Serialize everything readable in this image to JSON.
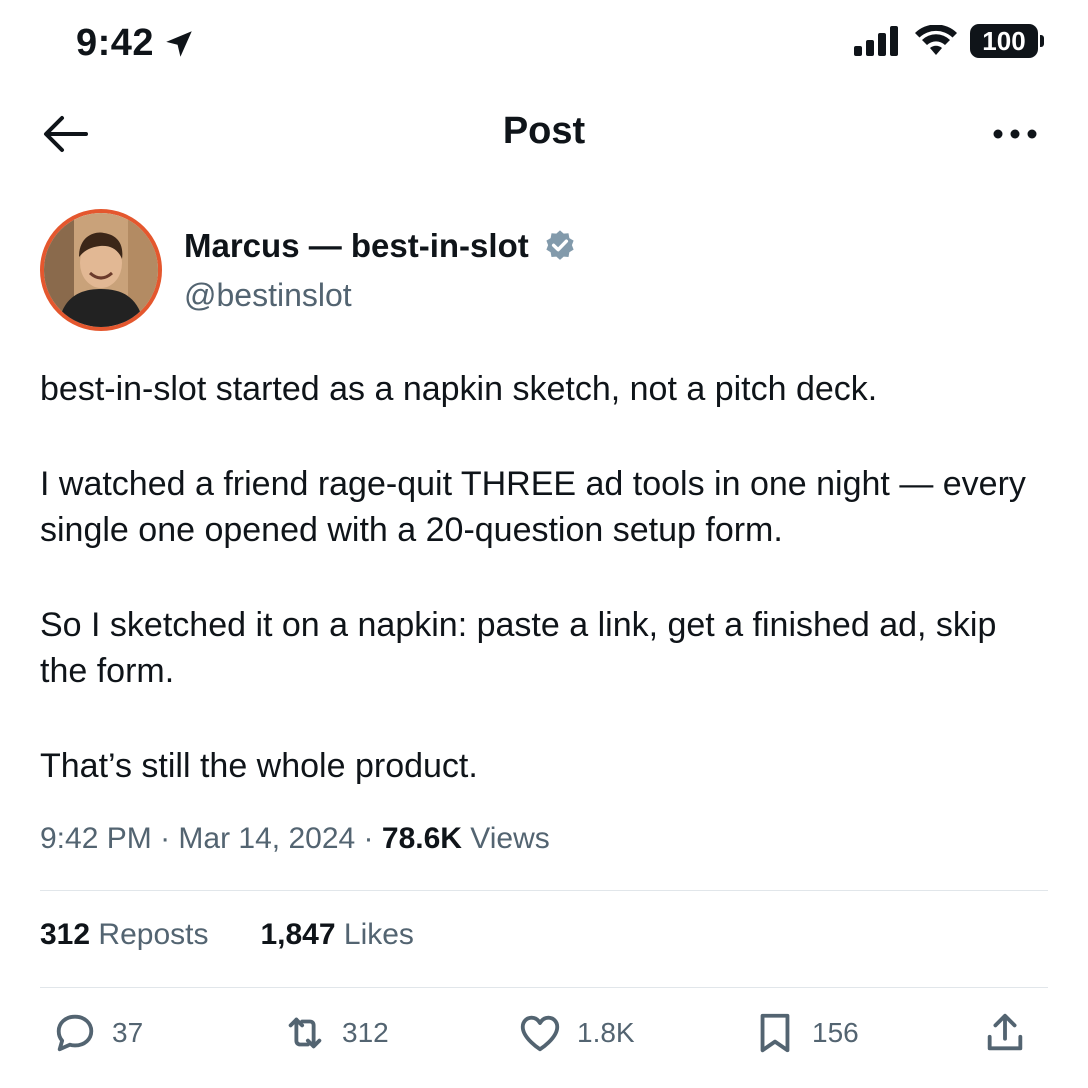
{
  "status_bar": {
    "time": "9:42",
    "battery": "100",
    "icons": [
      "location-arrow-icon",
      "cellular-signal-icon",
      "wifi-icon",
      "battery-icon"
    ]
  },
  "header": {
    "title": "Post",
    "back_icon": "back-arrow-icon",
    "more_icon": "more-dots-icon"
  },
  "author": {
    "display_name": "Marcus — best-in-slot",
    "handle": "@bestinslot",
    "verified_icon": "verified-badge-icon",
    "avatar_ring_color": "#e4572e"
  },
  "post": {
    "paragraphs": [
      "best-in-slot started as a napkin sketch, not a pitch deck.",
      "I watched a friend rage-quit THREE ad tools in one night — every single one opened with a 20-question setup form.",
      "So I sketched it on a napkin: paste a link, get a finished ad, skip the form.",
      "That’s still the whole product."
    ],
    "time": "9:42 PM",
    "date": "Mar 14, 2024",
    "views_count": "78.6K",
    "views_label": "Views",
    "separator": "·"
  },
  "stats": {
    "reposts_count": "312",
    "reposts_label": "Reposts",
    "likes_count": "1,847",
    "likes_label": "Likes"
  },
  "actions": {
    "reply_count": "37",
    "repost_count": "312",
    "like_count": "1.8K",
    "bookmark_count": "156",
    "icons": [
      "reply-icon",
      "repost-icon",
      "like-icon",
      "bookmark-icon",
      "share-icon"
    ]
  },
  "colors": {
    "text": "#0f1419",
    "secondary": "#536471",
    "divider": "#e1e6ea",
    "verified": "#829aab"
  }
}
